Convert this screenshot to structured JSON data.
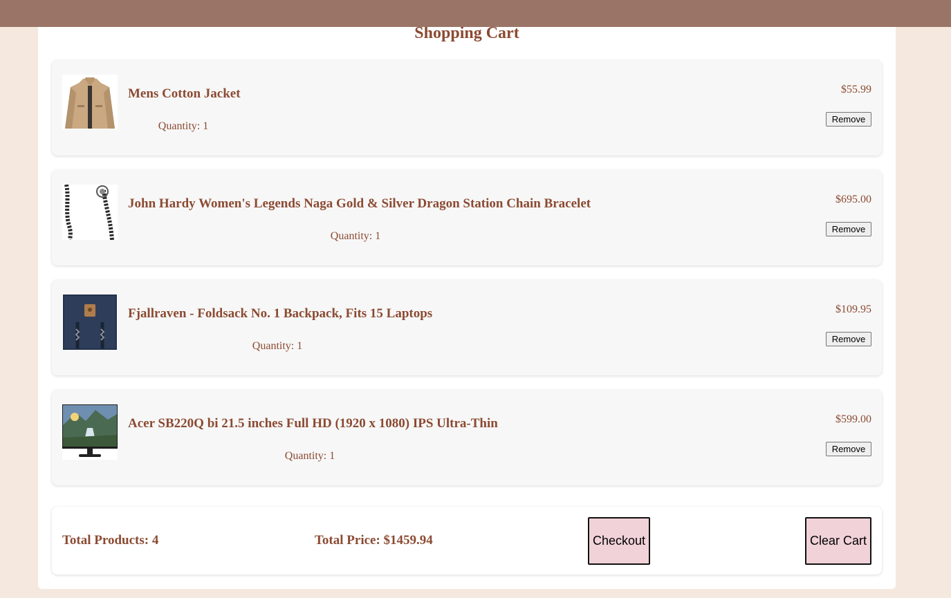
{
  "page": {
    "title": "Shopping Cart"
  },
  "cart": {
    "quantity_prefix": "Quantity: ",
    "remove_label": "Remove",
    "items": [
      {
        "name": "Mens Cotton Jacket",
        "quantity_text": "Quantity: 1",
        "price": "$55.99",
        "image_icon": "jacket-image"
      },
      {
        "name": "John Hardy Women's Legends Naga Gold & Silver Dragon Station Chain Bracelet",
        "quantity_text": "Quantity: 1",
        "price": "$695.00",
        "image_icon": "bracelet-image"
      },
      {
        "name": "Fjallraven - Foldsack No. 1 Backpack, Fits 15 Laptops",
        "quantity_text": "Quantity: 1",
        "price": "$109.95",
        "image_icon": "backpack-image"
      },
      {
        "name": "Acer SB220Q bi 21.5 inches Full HD (1920 x 1080) IPS Ultra-Thin",
        "quantity_text": "Quantity: 1",
        "price": "$599.00",
        "image_icon": "monitor-image"
      }
    ]
  },
  "summary": {
    "total_products": "Total Products: 4",
    "total_price": "Total Price: $1459.94",
    "checkout_label": "Checkout",
    "clear_label": "Clear Cart"
  },
  "colors": {
    "header_bar": "#9a7466",
    "page_background": "#f5e8de",
    "text_accent": "#8b4a32",
    "action_button_bg": "#f0d2d8"
  }
}
